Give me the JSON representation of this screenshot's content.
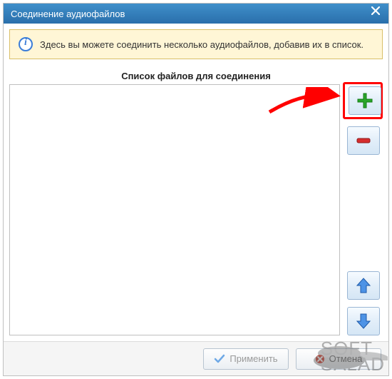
{
  "window": {
    "title": "Соединение аудиофайлов"
  },
  "info": {
    "text": "Здесь вы можете соединить несколько аудиофайлов, добавив их в список."
  },
  "list": {
    "header": "Список файлов для соединения"
  },
  "buttons": {
    "apply": "Применить",
    "cancel": "Отмена"
  },
  "icons": {
    "add": "plus-icon",
    "remove": "minus-icon",
    "move_up": "arrow-up-icon",
    "move_down": "arrow-down-icon",
    "info": "info-icon",
    "close": "close-icon",
    "check": "check-icon",
    "cancel": "cancel-icon"
  },
  "watermark": {
    "line1": "SOFT",
    "line2": "SALAD"
  },
  "colors": {
    "title_grad_top": "#3f8fca",
    "title_grad_bottom": "#2a6fab",
    "info_bg": "#fff6d6",
    "info_border": "#d9c06a",
    "annotation": "#ff0000",
    "plus": "#2aa52a",
    "minus": "#d62d2d",
    "arrow_blue": "#2e74d0"
  }
}
